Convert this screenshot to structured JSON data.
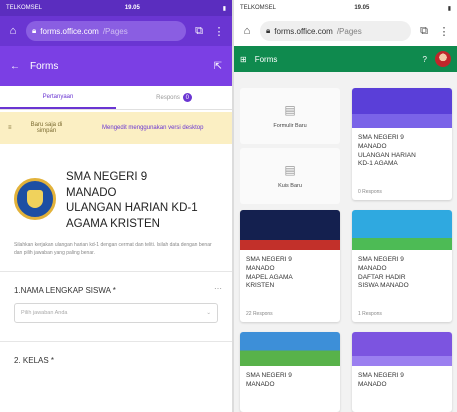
{
  "left": {
    "status": {
      "carrier": "TELKOMSEL",
      "time": "19.05"
    },
    "browser": {
      "host": "forms.office.com",
      "path": "/Pages"
    },
    "appbar": {
      "title": "Forms"
    },
    "tabs": [
      {
        "label": "Pertanyaan"
      },
      {
        "label": "Respons",
        "badge": "0"
      }
    ],
    "banner": {
      "text1": "Baru saja di simpan",
      "text2": "Mengedit menggunakan versi desktop"
    },
    "form": {
      "title_lines": [
        "SMA NEGERI 9",
        "MANADO",
        "ULANGAN HARIAN KD-1",
        "AGAMA KRISTEN"
      ],
      "description": "Silahkan kerjakan ulangan harian kd-1 dengan cermat dan teliti. Isilah data dengan benar dan pilih jawaban yang paling benar."
    },
    "questions": [
      {
        "label": "1.NAMA LENGKAP SISWA *",
        "placeholder": "Pilih jawaban Anda"
      },
      {
        "label": "2. KELAS *"
      }
    ]
  },
  "right": {
    "status": {
      "carrier": "TELKOMSEL",
      "time": "19.05"
    },
    "browser": {
      "host": "forms.office.com",
      "path": "/Pages"
    },
    "appbar": {
      "title": "Forms",
      "help": "?"
    },
    "templates": [
      {
        "label": "Formulir Baru"
      },
      {
        "label": "Kuis Baru"
      }
    ],
    "forms": [
      {
        "lines": [
          "SMA NEGERI 9",
          "MANADO",
          "ULANGAN HARIAN",
          "KD-1 AGAMA"
        ],
        "footer": "0 Respons"
      },
      {
        "lines": [
          "SMA NEGERI 9",
          "MANADO",
          "MAPEL AGAMA",
          "KRISTEN"
        ],
        "footer": "22 Respons"
      },
      {
        "lines": [
          "SMA NEGERI 9",
          "MANADO",
          "DAFTAR HADIR",
          "SISWA MANADO"
        ],
        "footer": "1 Respons"
      },
      {
        "lines": [
          "SMA NEGERI 9",
          "MANADO"
        ],
        "footer": ""
      },
      {
        "lines": [
          "SMA NEGERI 9",
          "MANADO"
        ],
        "footer": ""
      }
    ]
  }
}
